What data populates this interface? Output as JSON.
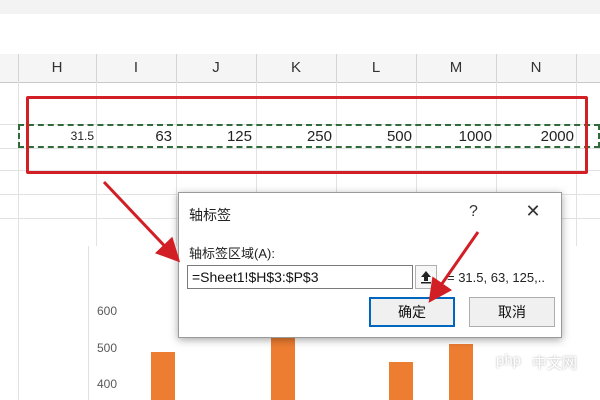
{
  "columns": [
    "H",
    "I",
    "J",
    "K",
    "L",
    "M",
    "N"
  ],
  "row_values": [
    "31.5",
    "63",
    "125",
    "250",
    "500",
    "1000",
    "2000"
  ],
  "chart": {
    "y_ticks": [
      "600",
      "500",
      "400"
    ],
    "bar_color": "#ed7d31"
  },
  "dialog": {
    "title": "轴标签",
    "help": "?",
    "close": "✕",
    "range_label": "轴标签区域(A):",
    "range_value": "=Sheet1!$H$3:$P$3",
    "preview": "= 31.5, 63, 125,..",
    "ok_label": "确定",
    "cancel_label": "取消"
  },
  "watermark": {
    "php": "php",
    "cn": "中文网"
  },
  "colors": {
    "red_annotation": "#d11f25",
    "dashed_border": "#2f6b3a",
    "primary_button_border": "#0067c0"
  }
}
